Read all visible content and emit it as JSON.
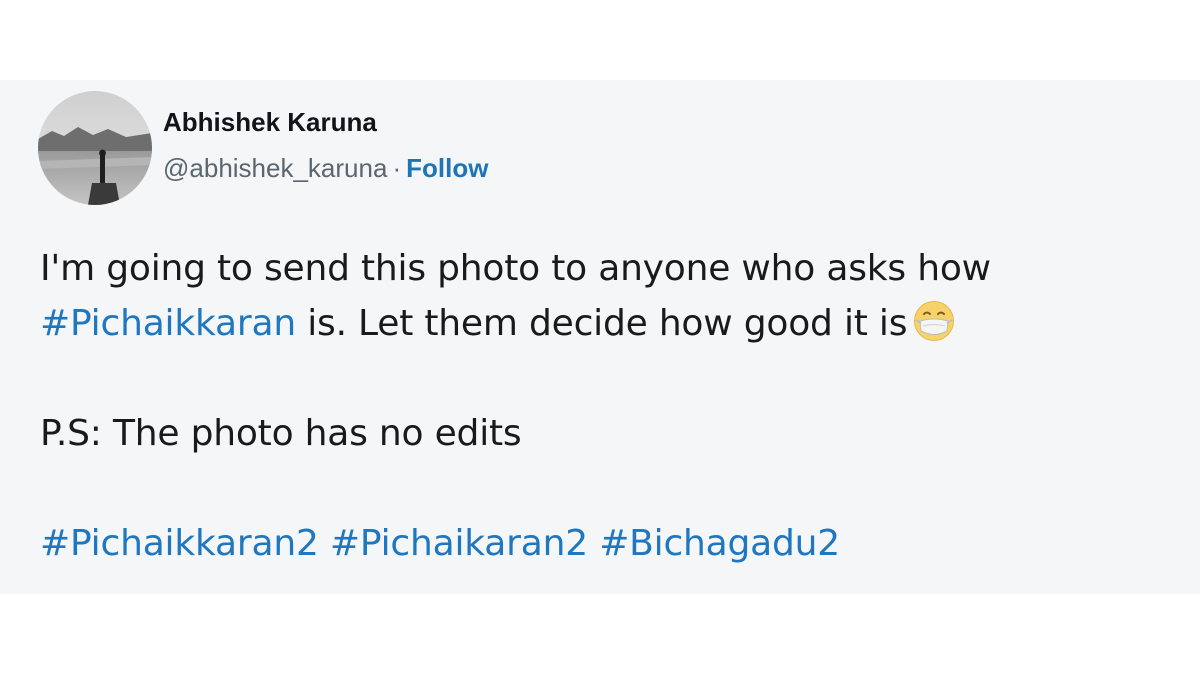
{
  "tweet": {
    "author": {
      "display_name": "Abhishek Karuna",
      "handle": "@abhishek_karuna",
      "separator": "·",
      "follow_label": "Follow",
      "avatar_icon": "profile-photo-lake-silhouette"
    },
    "body": {
      "line1": "I'm going to send this photo to anyone who asks how",
      "line2_hashtag": "#Pichaikkaran",
      "line2_text": " is. Let them decide how good it is",
      "line2_emoji": "face-with-medical-mask-icon",
      "ps_line": "P.S: The photo has no edits",
      "hashtags": [
        "#Pichaikkaran2",
        "#Pichaikaran2",
        "#Bichagadu2"
      ]
    }
  },
  "colors": {
    "card_background": "#f4f6f7",
    "link_blue": "#1f77c0",
    "text_dark": "#1a1a1a",
    "muted_gray": "#5b6670"
  }
}
